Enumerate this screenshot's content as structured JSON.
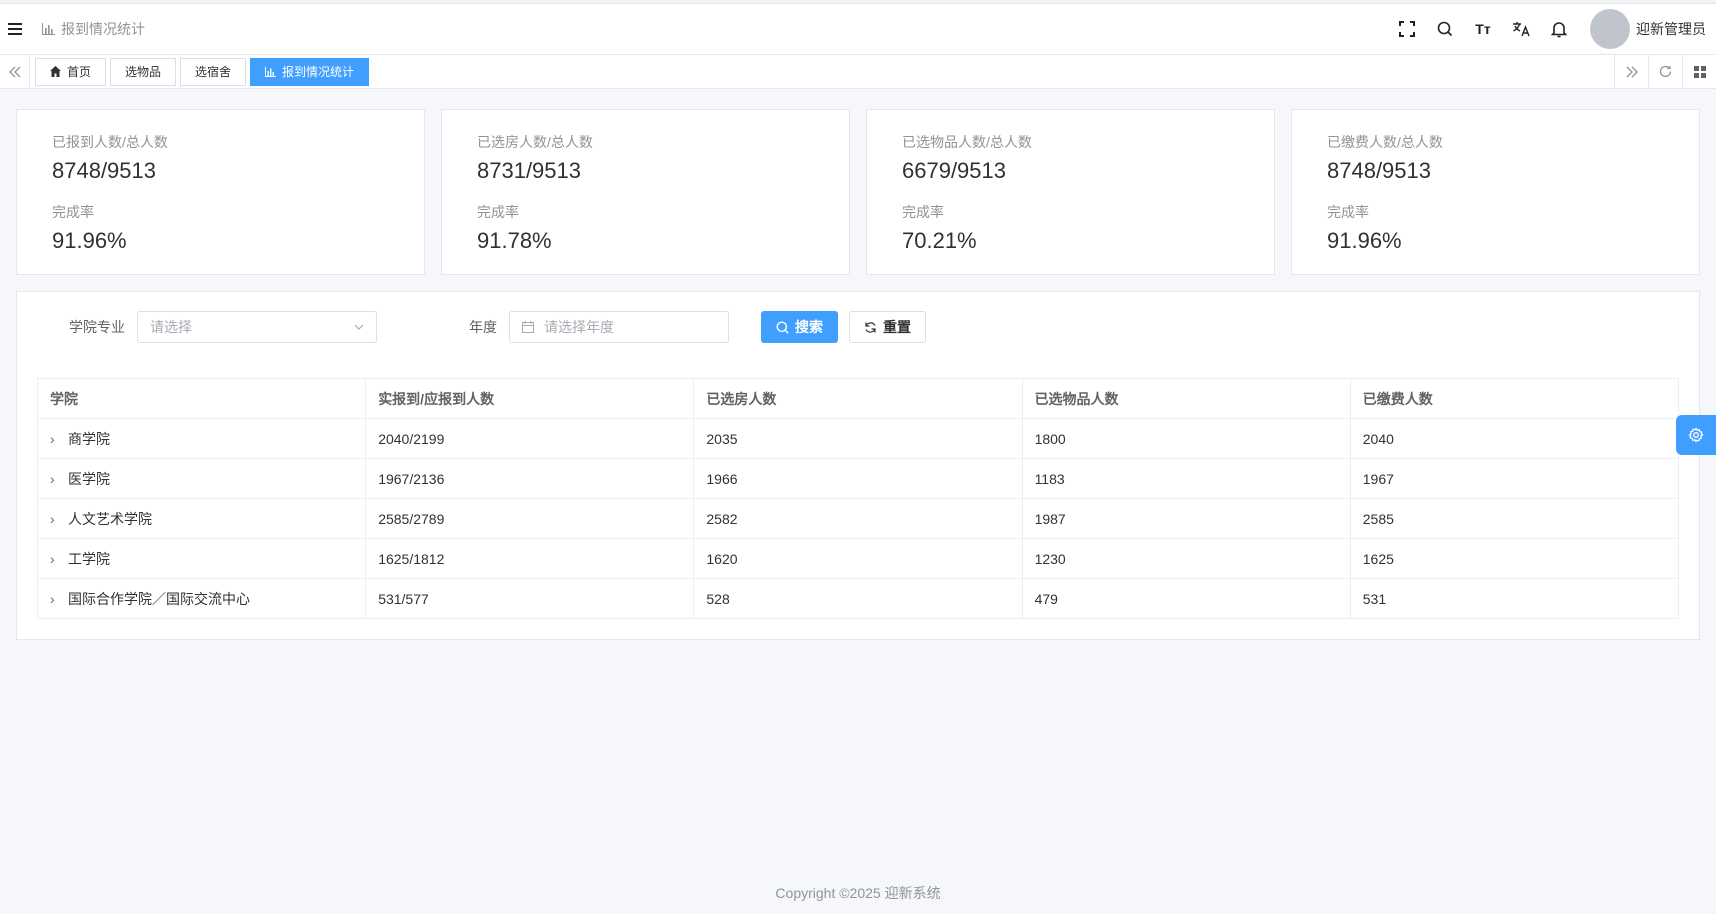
{
  "header": {
    "page_title": "报到情况统计",
    "user_name": "迎新管理员",
    "font_size_icon_text": "Tт"
  },
  "tabs": [
    {
      "label": "首页",
      "icon": "home-icon",
      "active": false
    },
    {
      "label": "选物品",
      "active": false
    },
    {
      "label": "选宿舍",
      "active": false
    },
    {
      "label": "报到情况统计",
      "icon": "bar-chart-icon",
      "active": true
    }
  ],
  "stats": [
    {
      "label1": "已报到人数/总人数",
      "value1": "8748/9513",
      "label2": "完成率",
      "value2": "91.96%"
    },
    {
      "label1": "已选房人数/总人数",
      "value1": "8731/9513",
      "label2": "完成率",
      "value2": "91.78%"
    },
    {
      "label1": "已选物品人数/总人数",
      "value1": "6679/9513",
      "label2": "完成率",
      "value2": "70.21%"
    },
    {
      "label1": "已缴费人数/总人数",
      "value1": "8748/9513",
      "label2": "完成率",
      "value2": "91.96%"
    }
  ],
  "filters": {
    "college_label": "学院专业",
    "college_placeholder": "请选择",
    "year_label": "年度",
    "year_placeholder": "请选择年度",
    "search_label": "搜索",
    "reset_label": "重置"
  },
  "table": {
    "columns": [
      "学院",
      "实报到/应报到人数",
      "已选房人数",
      "已选物品人数",
      "已缴费人数"
    ],
    "rows": [
      [
        "商学院",
        "2040/2199",
        "2035",
        "1800",
        "2040"
      ],
      [
        "医学院",
        "1967/2136",
        "1966",
        "1183",
        "1967"
      ],
      [
        "人文艺术学院",
        "2585/2789",
        "2582",
        "1987",
        "2585"
      ],
      [
        "工学院",
        "1625/1812",
        "1620",
        "1230",
        "1625"
      ],
      [
        "国际合作学院／国际交流中心",
        "531/577",
        "528",
        "479",
        "531"
      ]
    ]
  },
  "footer": {
    "copyright": "Copyright ©2025 迎新系统"
  }
}
